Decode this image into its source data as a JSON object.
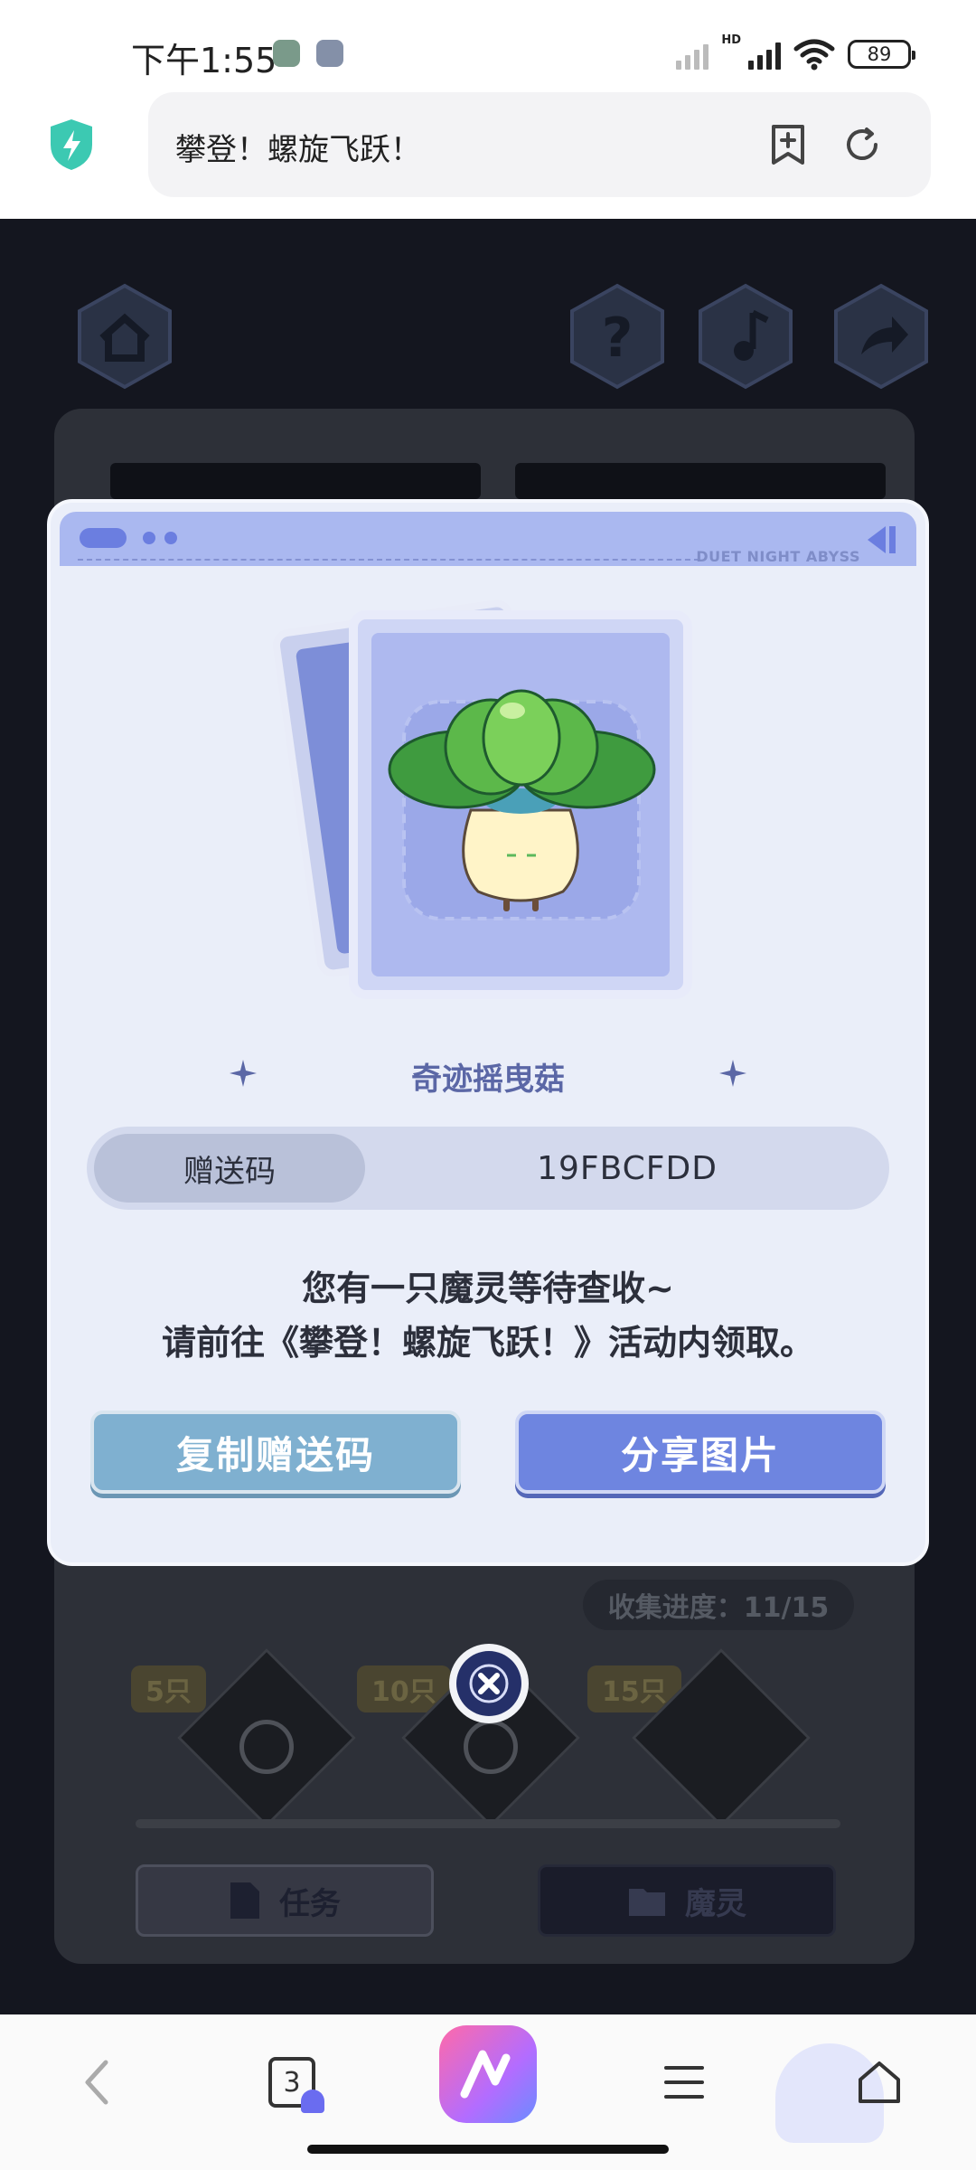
{
  "status_bar": {
    "time": "下午1:55",
    "hd_label": "HD",
    "battery": "89"
  },
  "address_bar": {
    "url_text": "攀登！螺旋飞跃！",
    "icons": [
      "shield-lightning-icon",
      "add-bookmark-icon",
      "refresh-icon"
    ]
  },
  "game_background": {
    "progress_text": "收集进度：11/15",
    "milestones": [
      "5只",
      "10只",
      "15只"
    ],
    "tabs": [
      "任务",
      "魔灵"
    ]
  },
  "modal": {
    "header_brand": "DUET NIGHT ABYSS",
    "item_name": "奇迹摇曳菇",
    "gift_code_label": "赠送码",
    "gift_code_value": "19FBCFDD",
    "message_line1": "您有一只魔灵等待查收~",
    "message_line2": "请前往《攀登！螺旋飞跃！》活动内领取。",
    "copy_button": "复制赠送码",
    "share_button": "分享图片"
  },
  "bottom_nav": {
    "tab_count": "3",
    "icons": [
      "back-icon",
      "tabs-icon",
      "ai-assistant-icon",
      "menu-icon",
      "home-icon"
    ]
  },
  "colors": {
    "modal_bg": "#eaeef9",
    "header_blue": "#aab8f0",
    "copy_button": "#7fb0d0",
    "share_button": "#6e85e0",
    "game_dark": "#14161f"
  }
}
